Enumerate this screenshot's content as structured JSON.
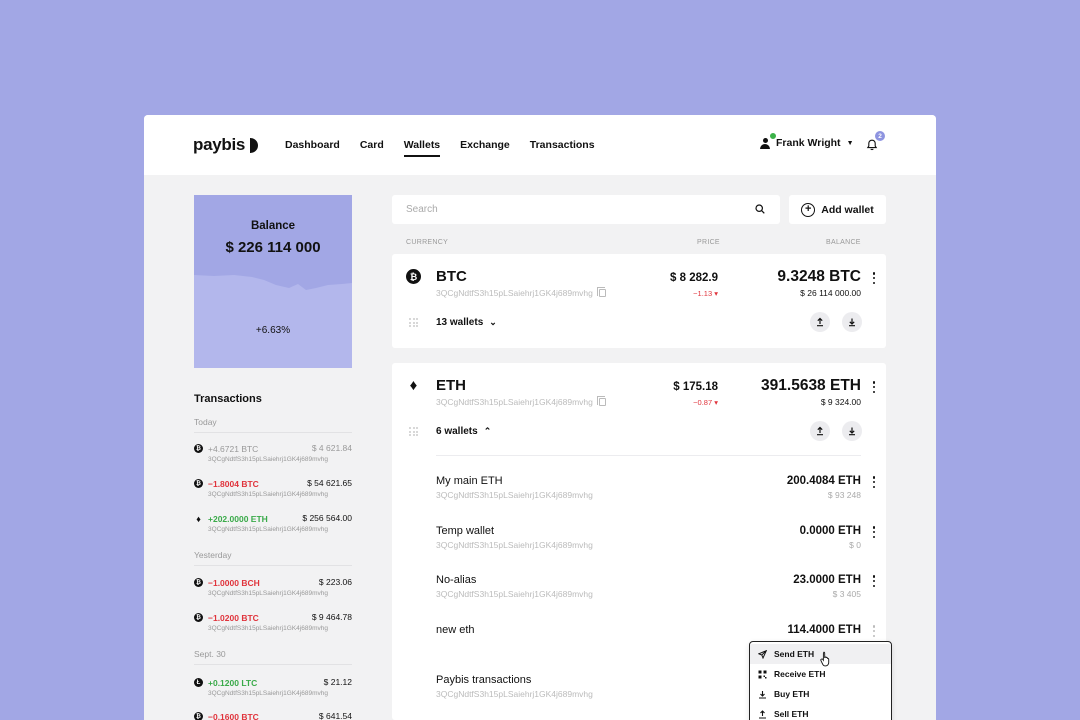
{
  "brand": "paybis",
  "nav": [
    "Dashboard",
    "Card",
    "Wallets",
    "Exchange",
    "Transactions"
  ],
  "nav_active": "Wallets",
  "user": {
    "name": "Frank Wright",
    "notifications": "2"
  },
  "balance": {
    "label": "Balance",
    "value": "$ 226 114 000",
    "change": "+6.63%"
  },
  "transactions": {
    "title": "Transactions",
    "groups": [
      "Today",
      "Yesterday",
      "Sept. 30"
    ],
    "items": [
      {
        "coin": "BTC",
        "amount": "+4.6721 BTC",
        "usd": "$ 4 621.84",
        "addr": "3QCgNdtfS3h15pLSaiehrj1GK4j689mvhg",
        "state": "muted"
      },
      {
        "coin": "BTC",
        "amount": "−1.8004 BTC",
        "usd": "$ 54 621.65",
        "addr": "3QCgNdtfS3h15pLSaiehrj1GK4j689mvhg",
        "state": "neg"
      },
      {
        "coin": "ETH",
        "amount": "+202.0000 ETH",
        "usd": "$ 256 564.00",
        "addr": "3QCgNdtfS3h15pLSaiehrj1GK4j689mvhg",
        "state": "pos"
      },
      {
        "coin": "BCH",
        "amount": "−1.0000 BCH",
        "usd": "$ 223.06",
        "addr": "3QCgNdtfS3h15pLSaiehrj1GK4j689mvhg",
        "state": "neg"
      },
      {
        "coin": "BTC",
        "amount": "−1.0200 BTC",
        "usd": "$ 9 464.78",
        "addr": "3QCgNdtfS3h15pLSaiehrj1GK4j689mvhg",
        "state": "neg"
      },
      {
        "coin": "LTC",
        "amount": "+0.1200 LTC",
        "usd": "$ 21.12",
        "addr": "3QCgNdtfS3h15pLSaiehrj1GK4j689mvhg",
        "state": "pos"
      },
      {
        "coin": "BTC",
        "amount": "−0.1600 BTC",
        "usd": "$ 641.54",
        "addr": "",
        "state": "neg"
      }
    ]
  },
  "search": {
    "placeholder": "Search"
  },
  "add_wallet": "Add wallet",
  "columns": {
    "currency": "CURRENCY",
    "price": "PRICE",
    "balance": "BALANCE"
  },
  "coins": [
    {
      "symbol": "BTC",
      "icon": "bitcoin-icon",
      "addr": "3QCgNdtfS3h15pLSaiehrj1GK4j689mvhg",
      "price": "$ 8 282.9",
      "price_change": "−1.13 ▾",
      "balance": "9.3248 BTC",
      "balance_usd": "$ 26 114 000.00",
      "wallets": "13 wallets"
    },
    {
      "symbol": "ETH",
      "icon": "ethereum-icon",
      "addr": "3QCgNdtfS3h15pLSaiehrj1GK4j689mvhg",
      "price": "$ 175.18",
      "price_change": "−0.87 ▾",
      "balance": "391.5638 ETH",
      "balance_usd": "$ 9 324.00",
      "wallets": "6 wallets"
    }
  ],
  "eth_wallets": [
    {
      "name": "My main ETH",
      "addr": "3QCgNdtfS3h15pLSaiehrj1GK4j689mvhg",
      "balance": "200.4084 ETH",
      "usd": "$ 93 248"
    },
    {
      "name": "Temp wallet",
      "addr": "3QCgNdtfS3h15pLSaiehrj1GK4j689mvhg",
      "balance": "0.0000 ETH",
      "usd": "$ 0"
    },
    {
      "name": "No-alias",
      "addr": "3QCgNdtfS3h15pLSaiehrj1GK4j689mvhg",
      "balance": "23.0000 ETH",
      "usd": "$ 3 405"
    },
    {
      "name": "new eth",
      "addr": "",
      "balance": "114.4000 ETH",
      "usd": ""
    },
    {
      "name": "Paybis transactions",
      "addr": "3QCgNdtfS3h15pLSaiehrj1GK4j689mvhg",
      "balance": "",
      "usd": ""
    }
  ],
  "context_menu": [
    "Send ETH",
    "Receive ETH",
    "Buy ETH",
    "Sell ETH"
  ],
  "colors": {
    "accent": "#a2a7e5",
    "positive": "#3aaa49",
    "negative": "#e0343c",
    "verified": "#3cb249"
  }
}
